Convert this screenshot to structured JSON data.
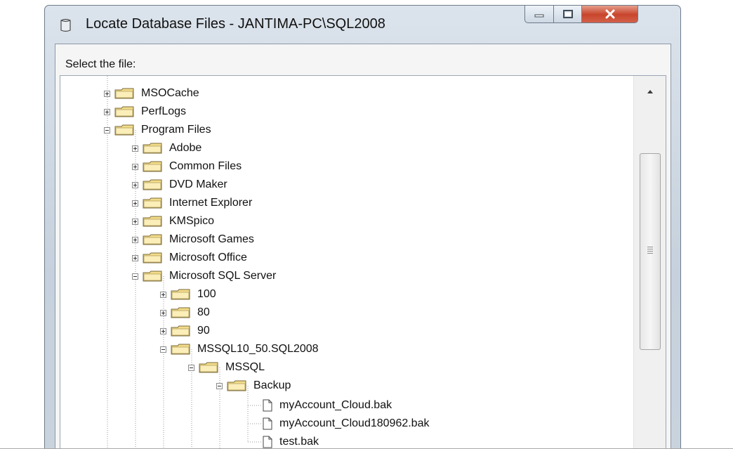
{
  "window": {
    "title": "Locate Database Files - JANTIMA-PC\\SQL2008",
    "title_icon": "database-icon",
    "buttons": [
      "minimize-icon",
      "maximize-icon",
      "close-icon"
    ]
  },
  "dialog": {
    "prompt": "Select the file:"
  },
  "tree": {
    "nodes": [
      {
        "label": "MSOCache",
        "type": "folder",
        "expanded": false
      },
      {
        "label": "PerfLogs",
        "type": "folder",
        "expanded": false
      },
      {
        "label": "Program Files",
        "type": "folder",
        "expanded": true
      },
      {
        "label": "Adobe",
        "type": "folder",
        "expanded": false
      },
      {
        "label": "Common Files",
        "type": "folder",
        "expanded": false
      },
      {
        "label": "DVD Maker",
        "type": "folder",
        "expanded": false
      },
      {
        "label": "Internet Explorer",
        "type": "folder",
        "expanded": false
      },
      {
        "label": "KMSpico",
        "type": "folder",
        "expanded": false
      },
      {
        "label": "Microsoft Games",
        "type": "folder",
        "expanded": false
      },
      {
        "label": "Microsoft Office",
        "type": "folder",
        "expanded": false
      },
      {
        "label": "Microsoft SQL Server",
        "type": "folder",
        "expanded": true
      },
      {
        "label": "100",
        "type": "folder",
        "expanded": false
      },
      {
        "label": "80",
        "type": "folder",
        "expanded": false
      },
      {
        "label": "90",
        "type": "folder",
        "expanded": false
      },
      {
        "label": "MSSQL10_50.SQL2008",
        "type": "folder",
        "expanded": true
      },
      {
        "label": "MSSQL",
        "type": "folder",
        "expanded": true
      },
      {
        "label": "Backup",
        "type": "folder",
        "expanded": true
      },
      {
        "label": "myAccount_Cloud.bak",
        "type": "file"
      },
      {
        "label": "myAccount_Cloud180962.bak",
        "type": "file"
      },
      {
        "label": "test.bak",
        "type": "file"
      }
    ]
  },
  "colors": {
    "title_bar": "#c6d1dd",
    "close_button": "#c8452c",
    "folder": "#f3dc8a"
  }
}
